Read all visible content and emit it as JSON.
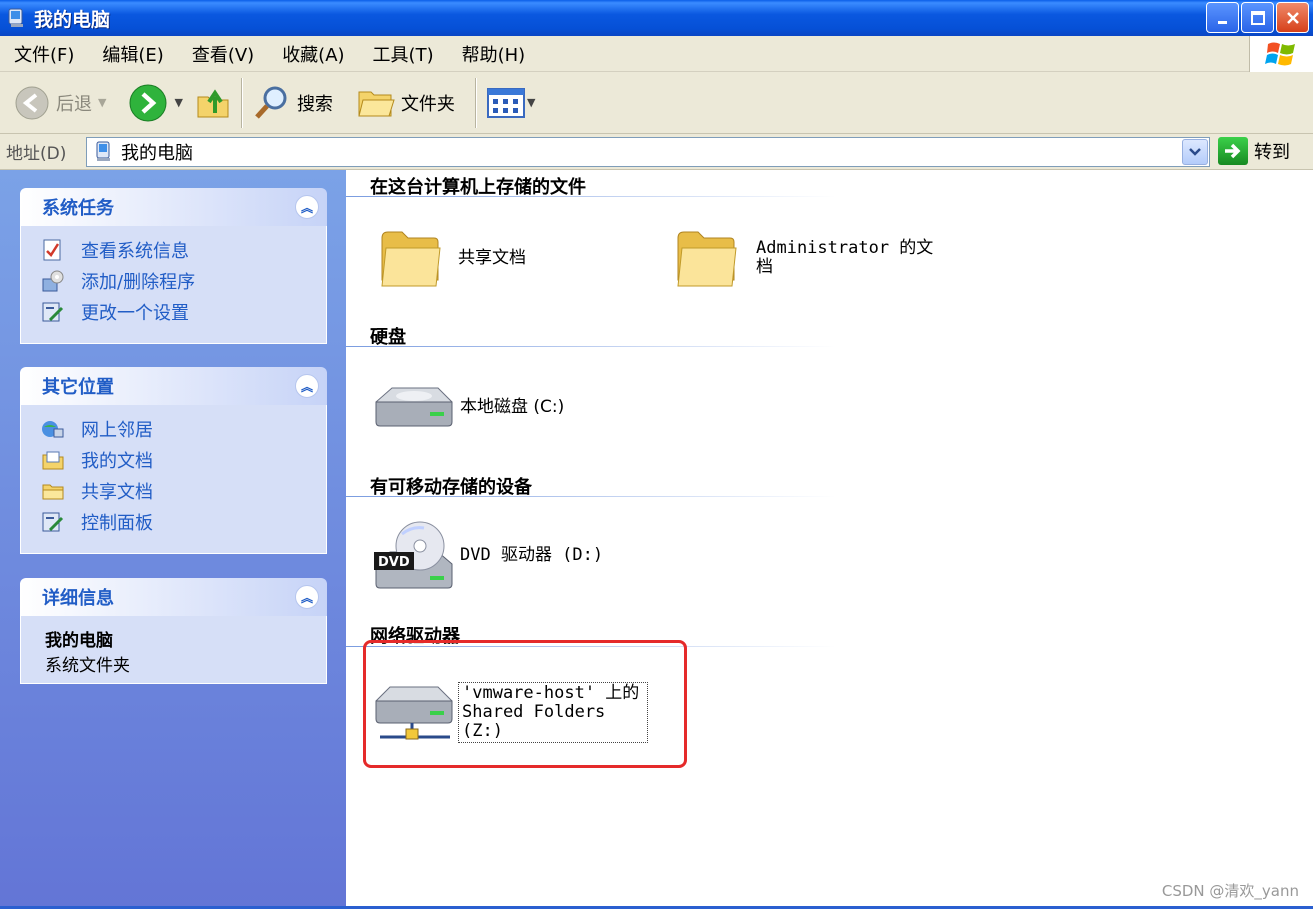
{
  "window": {
    "title": "我的电脑"
  },
  "menu": [
    "文件(F)",
    "编辑(E)",
    "查看(V)",
    "收藏(A)",
    "工具(T)",
    "帮助(H)"
  ],
  "toolbar": {
    "back": "后退",
    "search": "搜索",
    "folders": "文件夹"
  },
  "address": {
    "label": "地址(D)",
    "value": "我的电脑",
    "go": "转到"
  },
  "left": {
    "system_tasks": {
      "title": "系统任务",
      "items": [
        "查看系统信息",
        "添加/删除程序",
        "更改一个设置"
      ]
    },
    "other_places": {
      "title": "其它位置",
      "items": [
        "网上邻居",
        "我的文档",
        "共享文档",
        "控制面板"
      ]
    },
    "details": {
      "title": "详细信息",
      "name": "我的电脑",
      "type": "系统文件夹"
    }
  },
  "main": {
    "stored_files": {
      "title": "在这台计算机上存储的文件",
      "items": [
        "共享文档",
        "Administrator 的文档"
      ]
    },
    "hard_disks": {
      "title": "硬盘",
      "items": [
        "本地磁盘 (C:)"
      ]
    },
    "removable": {
      "title": "有可移动存储的设备",
      "items": [
        "DVD 驱动器 (D:)"
      ],
      "dvd_badge": "DVD"
    },
    "network": {
      "title": "网络驱动器",
      "items": [
        "'vmware-host' 上的 Shared Folders (Z:)"
      ]
    }
  },
  "watermark": "CSDN @清欢_yann",
  "colors": {
    "titlebar": "#0a58e0",
    "link": "#215dc6",
    "highlight": "#e52a2a"
  }
}
